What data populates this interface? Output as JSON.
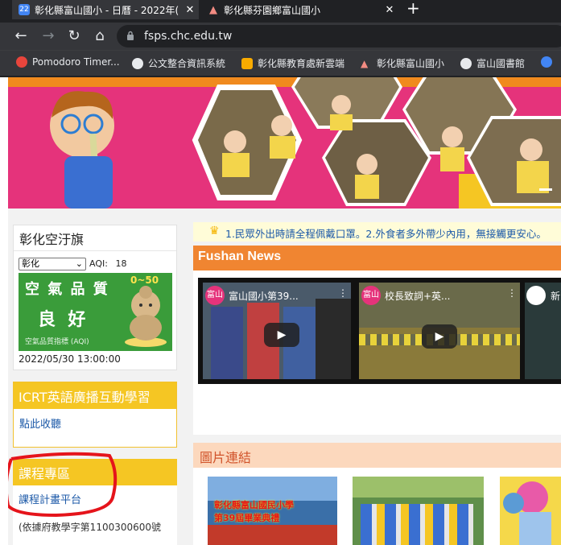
{
  "browser": {
    "tabs": [
      {
        "title": "彰化縣富山國小 - 日曆 - 2022年(",
        "icon": "calendar-icon",
        "icon_text": "22"
      },
      {
        "title": "彰化縣芬園鄉富山國小",
        "icon": "warning-triangle-icon"
      }
    ],
    "url": "fsps.chc.edu.tw",
    "bookmarks": [
      {
        "label": "Pomodoro Timer...",
        "icon": "check-circle-icon",
        "color": "#e8453c"
      },
      {
        "label": "公文整合資訊系統",
        "icon": "globe-icon",
        "color": "#e8eaed"
      },
      {
        "label": "彰化縣教育處新雲端",
        "icon": "weather-icon",
        "color": "#f9ab00"
      },
      {
        "label": "彰化縣富山國小",
        "icon": "warning-triangle-icon",
        "color": "#f28b82"
      },
      {
        "label": "富山國書館",
        "icon": "globe-icon",
        "color": "#e8eaed"
      }
    ]
  },
  "air": {
    "title": "彰化空汙旗",
    "select": "彰化",
    "aqi_label": "AQI:",
    "aqi_value": "18",
    "flag_title": "空 氣 品 質",
    "flag_range": "0~50",
    "flag_status": "良  好",
    "flag_sub": "空氣品質指標 (AQI)",
    "time": "2022/05/30 13:00:00"
  },
  "icrt": {
    "title": "ICRT英語廣播互動學習",
    "link": "點此收聽"
  },
  "course": {
    "title": "課程專區",
    "link": "課程計畫平台",
    "note": "(依據府教學字第1100300600號"
  },
  "marquee": "1.民眾外出時請全程佩戴口罩。2.外食者多外帶少內用，無接觸更安心。",
  "news": {
    "title": "Fushan News",
    "videos": [
      {
        "channel": "富山",
        "title": "富山國小第39..."
      },
      {
        "channel": "富山",
        "title": "校長致詞+英..."
      },
      {
        "title": "新"
      }
    ]
  },
  "gallery": {
    "title": "圖片連結",
    "thumb1_text": "彰化縣富山國民小學\n第39屆畢業典禮"
  },
  "colors": {
    "pink": "#e5337b",
    "orange": "#f08531",
    "yellow": "#f5c623",
    "annotation": "#e5141b"
  }
}
